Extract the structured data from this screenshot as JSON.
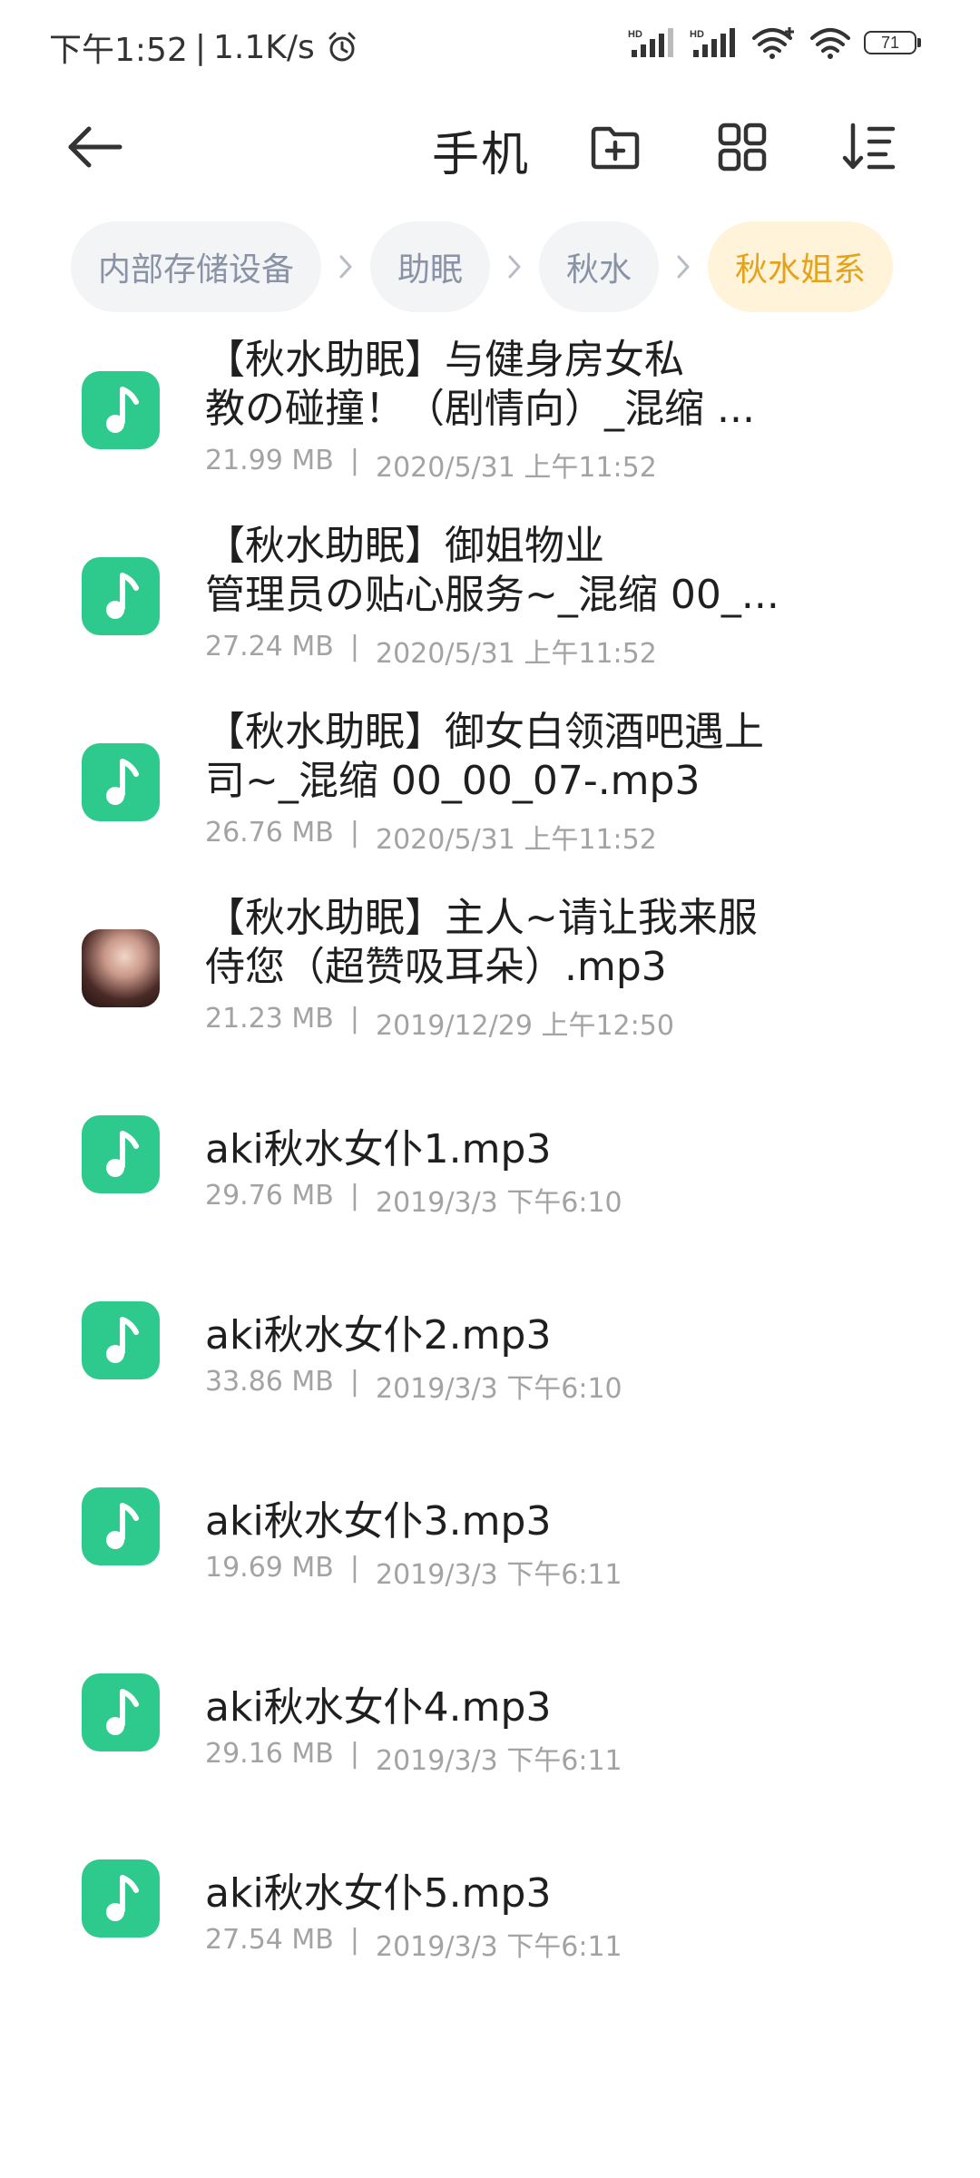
{
  "status_bar": {
    "time": "下午1:52",
    "net_speed": "1.1K/s",
    "battery": "71"
  },
  "toolbar": {
    "title": "手机"
  },
  "breadcrumb": [
    "内部存储设备",
    "助眠",
    "秋水",
    "秋水姐系"
  ],
  "colors": {
    "accent": "#e6a21a",
    "music_icon": "#2ec98c",
    "meta_text": "#a3a3a3"
  },
  "files": [
    {
      "line1": "【秋水助眠】与健身房女私",
      "line2": "教の碰撞！（剧情向）_混缩 ...",
      "size": "21.99 MB",
      "date": "2020/5/31 上午11:52",
      "icon": "music-file-icon"
    },
    {
      "line1": "【秋水助眠】御姐物业",
      "line2": "管理员の贴心服务~_混缩 00_...",
      "size": "27.24 MB",
      "date": "2020/5/31 上午11:52",
      "icon": "music-file-icon"
    },
    {
      "line1": "【秋水助眠】御女白领酒吧遇上",
      "line2": "司~_混缩 00_00_07-.mp3",
      "size": "26.76 MB",
      "date": "2020/5/31 上午11:52",
      "icon": "music-file-icon"
    },
    {
      "line1": "【秋水助眠】主人~请让我来服",
      "line2": "侍您（超赞吸耳朵）.mp3",
      "size": "21.23 MB",
      "date": "2019/12/29 上午12:50",
      "icon": "album-thumbnail"
    },
    {
      "line1": "aki秋水女仆1.mp3",
      "line2": "",
      "size": "29.76 MB",
      "date": "2019/3/3 下午6:10",
      "icon": "music-file-icon"
    },
    {
      "line1": "aki秋水女仆2.mp3",
      "line2": "",
      "size": "33.86 MB",
      "date": "2019/3/3 下午6:10",
      "icon": "music-file-icon"
    },
    {
      "line1": "aki秋水女仆3.mp3",
      "line2": "",
      "size": "19.69 MB",
      "date": "2019/3/3 下午6:11",
      "icon": "music-file-icon"
    },
    {
      "line1": "aki秋水女仆4.mp3",
      "line2": "",
      "size": "29.16 MB",
      "date": "2019/3/3 下午6:11",
      "icon": "music-file-icon"
    },
    {
      "line1": "aki秋水女仆5.mp3",
      "line2": "",
      "size": "27.54 MB",
      "date": "2019/3/3 下午6:11",
      "icon": "music-file-icon"
    }
  ]
}
